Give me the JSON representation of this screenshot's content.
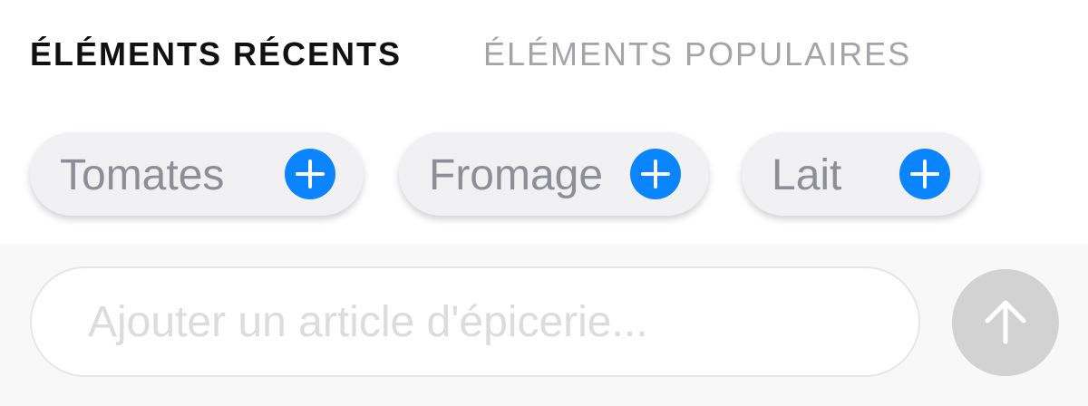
{
  "tabs": {
    "recent_label": "ÉLÉMENTS RÉCENTS",
    "popular_label": "ÉLÉMENTS POPULAIRES"
  },
  "suggestions": [
    {
      "label": "Tomates",
      "icon": "plus-icon"
    },
    {
      "label": "Fromage",
      "icon": "plus-icon"
    },
    {
      "label": "Lait",
      "icon": "plus-icon"
    }
  ],
  "composer": {
    "input_value": "",
    "placeholder": "Ajouter un article d'épicerie...",
    "send_icon": "arrow-up-icon"
  },
  "colors": {
    "accent": "#0a84ff",
    "chip_background": "#f1f1f3",
    "send_button_disabled": "#d2d2d2"
  }
}
